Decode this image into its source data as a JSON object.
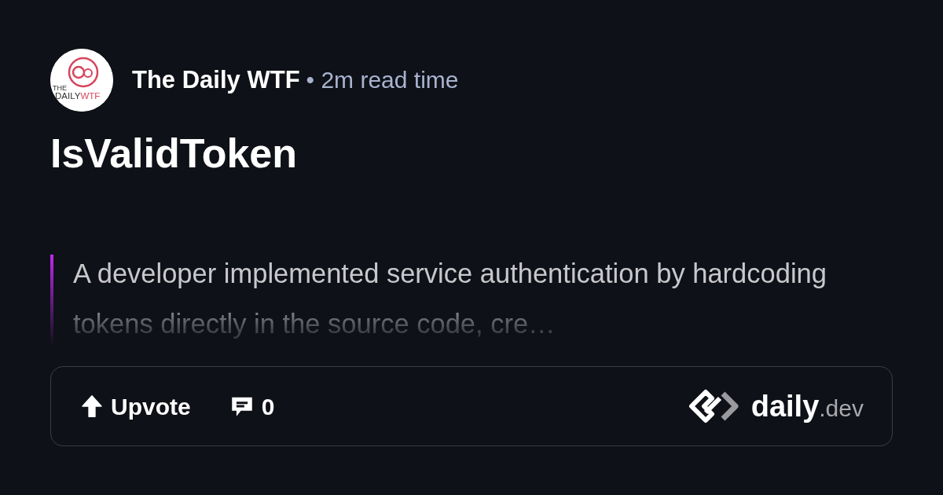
{
  "source": {
    "logo": {
      "top": "THE",
      "word1": "DAILY",
      "word2": "WTF"
    },
    "name": "The Daily WTF",
    "separator": "•",
    "read_time": "2m read time"
  },
  "title": "IsValidToken",
  "excerpt": "A developer implemented service authentication by hardcoding tokens directly in the source code, cre…",
  "footer": {
    "upvote": "Upvote",
    "comments": "0",
    "brand": {
      "name": "daily",
      "suffix": ".dev"
    }
  }
}
